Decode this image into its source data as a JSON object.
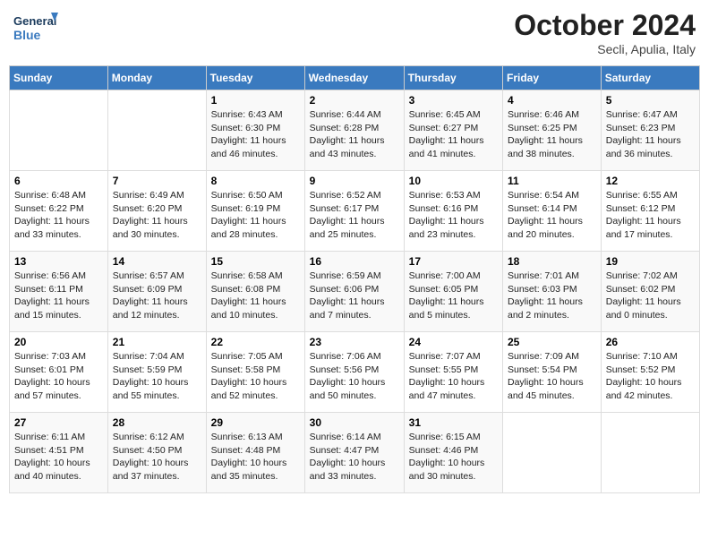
{
  "header": {
    "logo": {
      "line1": "General",
      "line2": "Blue"
    },
    "title": "October 2024",
    "location": "Secli, Apulia, Italy"
  },
  "weekdays": [
    "Sunday",
    "Monday",
    "Tuesday",
    "Wednesday",
    "Thursday",
    "Friday",
    "Saturday"
  ],
  "weeks": [
    [
      null,
      null,
      {
        "day": "1",
        "sunrise": "6:43 AM",
        "sunset": "6:30 PM",
        "daylight": "11 hours and 46 minutes."
      },
      {
        "day": "2",
        "sunrise": "6:44 AM",
        "sunset": "6:28 PM",
        "daylight": "11 hours and 43 minutes."
      },
      {
        "day": "3",
        "sunrise": "6:45 AM",
        "sunset": "6:27 PM",
        "daylight": "11 hours and 41 minutes."
      },
      {
        "day": "4",
        "sunrise": "6:46 AM",
        "sunset": "6:25 PM",
        "daylight": "11 hours and 38 minutes."
      },
      {
        "day": "5",
        "sunrise": "6:47 AM",
        "sunset": "6:23 PM",
        "daylight": "11 hours and 36 minutes."
      }
    ],
    [
      {
        "day": "6",
        "sunrise": "6:48 AM",
        "sunset": "6:22 PM",
        "daylight": "11 hours and 33 minutes."
      },
      {
        "day": "7",
        "sunrise": "6:49 AM",
        "sunset": "6:20 PM",
        "daylight": "11 hours and 30 minutes."
      },
      {
        "day": "8",
        "sunrise": "6:50 AM",
        "sunset": "6:19 PM",
        "daylight": "11 hours and 28 minutes."
      },
      {
        "day": "9",
        "sunrise": "6:52 AM",
        "sunset": "6:17 PM",
        "daylight": "11 hours and 25 minutes."
      },
      {
        "day": "10",
        "sunrise": "6:53 AM",
        "sunset": "6:16 PM",
        "daylight": "11 hours and 23 minutes."
      },
      {
        "day": "11",
        "sunrise": "6:54 AM",
        "sunset": "6:14 PM",
        "daylight": "11 hours and 20 minutes."
      },
      {
        "day": "12",
        "sunrise": "6:55 AM",
        "sunset": "6:12 PM",
        "daylight": "11 hours and 17 minutes."
      }
    ],
    [
      {
        "day": "13",
        "sunrise": "6:56 AM",
        "sunset": "6:11 PM",
        "daylight": "11 hours and 15 minutes."
      },
      {
        "day": "14",
        "sunrise": "6:57 AM",
        "sunset": "6:09 PM",
        "daylight": "11 hours and 12 minutes."
      },
      {
        "day": "15",
        "sunrise": "6:58 AM",
        "sunset": "6:08 PM",
        "daylight": "11 hours and 10 minutes."
      },
      {
        "day": "16",
        "sunrise": "6:59 AM",
        "sunset": "6:06 PM",
        "daylight": "11 hours and 7 minutes."
      },
      {
        "day": "17",
        "sunrise": "7:00 AM",
        "sunset": "6:05 PM",
        "daylight": "11 hours and 5 minutes."
      },
      {
        "day": "18",
        "sunrise": "7:01 AM",
        "sunset": "6:03 PM",
        "daylight": "11 hours and 2 minutes."
      },
      {
        "day": "19",
        "sunrise": "7:02 AM",
        "sunset": "6:02 PM",
        "daylight": "11 hours and 0 minutes."
      }
    ],
    [
      {
        "day": "20",
        "sunrise": "7:03 AM",
        "sunset": "6:01 PM",
        "daylight": "10 hours and 57 minutes."
      },
      {
        "day": "21",
        "sunrise": "7:04 AM",
        "sunset": "5:59 PM",
        "daylight": "10 hours and 55 minutes."
      },
      {
        "day": "22",
        "sunrise": "7:05 AM",
        "sunset": "5:58 PM",
        "daylight": "10 hours and 52 minutes."
      },
      {
        "day": "23",
        "sunrise": "7:06 AM",
        "sunset": "5:56 PM",
        "daylight": "10 hours and 50 minutes."
      },
      {
        "day": "24",
        "sunrise": "7:07 AM",
        "sunset": "5:55 PM",
        "daylight": "10 hours and 47 minutes."
      },
      {
        "day": "25",
        "sunrise": "7:09 AM",
        "sunset": "5:54 PM",
        "daylight": "10 hours and 45 minutes."
      },
      {
        "day": "26",
        "sunrise": "7:10 AM",
        "sunset": "5:52 PM",
        "daylight": "10 hours and 42 minutes."
      }
    ],
    [
      {
        "day": "27",
        "sunrise": "6:11 AM",
        "sunset": "4:51 PM",
        "daylight": "10 hours and 40 minutes."
      },
      {
        "day": "28",
        "sunrise": "6:12 AM",
        "sunset": "4:50 PM",
        "daylight": "10 hours and 37 minutes."
      },
      {
        "day": "29",
        "sunrise": "6:13 AM",
        "sunset": "4:48 PM",
        "daylight": "10 hours and 35 minutes."
      },
      {
        "day": "30",
        "sunrise": "6:14 AM",
        "sunset": "4:47 PM",
        "daylight": "10 hours and 33 minutes."
      },
      {
        "day": "31",
        "sunrise": "6:15 AM",
        "sunset": "4:46 PM",
        "daylight": "10 hours and 30 minutes."
      },
      null,
      null
    ]
  ]
}
